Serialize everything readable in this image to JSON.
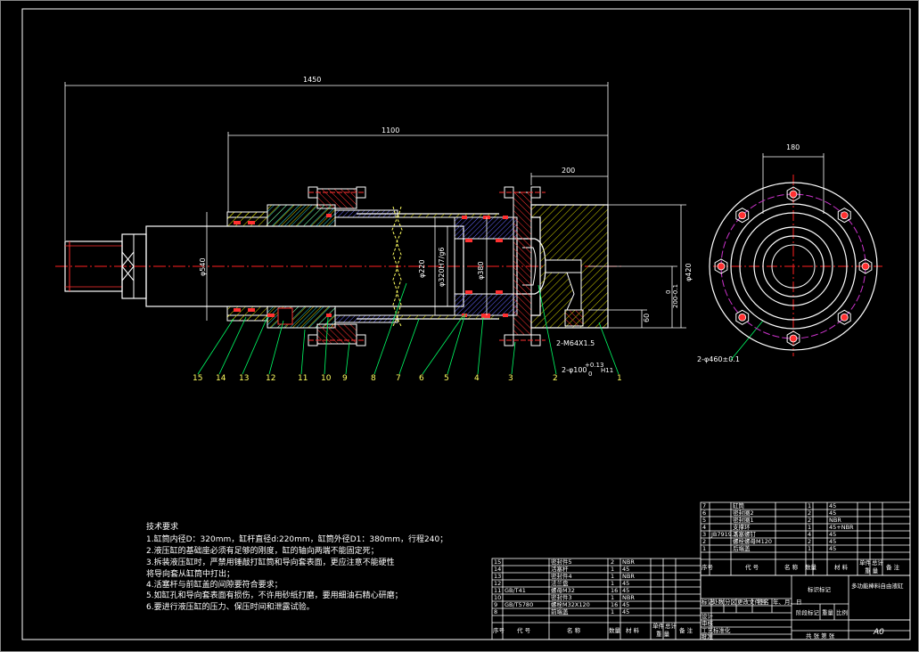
{
  "dimensions": {
    "overall_length": "1450",
    "stroke_length": "1100",
    "head_length": "200",
    "end_diameter": "φ540",
    "rod_diameter": "φ220",
    "piston_fit": "φ320H7/g6",
    "piston_diameter": "φ380",
    "flange_diameter": "φ420",
    "tol_upper": "0",
    "tol_lower": "200-0.1",
    "port_offset": "60",
    "thread_spec": "2-M64X1.5",
    "hole_spec": "2-φ100",
    "hole_tol_a": "+0.13",
    "hole_tol_b": "0",
    "hole_fit": "H11",
    "end_width": "180",
    "bolt_circle": "2-φ460±0.1"
  },
  "callouts": [
    "15",
    "14",
    "13",
    "12",
    "11",
    "10",
    "9",
    "8",
    "7",
    "6",
    "5",
    "4",
    "3",
    "2",
    "1"
  ],
  "tech": {
    "title": "技术要求",
    "lines": [
      "1.缸筒内径D：320mm，缸杆直径d:220mm，缸筒外径D1：380mm，行程240；",
      "2.液压缸的基础座必须有足够的刚度，缸的轴向两端不能固定死；",
      "3.拆装液压缸时，严禁用锤敲打缸筒和导向套表面，更应注意不能硬性",
      "将导向套从缸筒中打出；",
      "4.活塞杆与前缸盖的间隙要符合要求；",
      "5.如缸孔和导向套表面有损伤，不许用砂纸打磨，要用细油石精心研磨；",
      "6.要进行液压缸的压力、保压时间和泄露试验。"
    ]
  },
  "bom_upper": [
    {
      "no": "7",
      "code": "",
      "name": "缸筒",
      "qty": "1",
      "mat": "45"
    },
    {
      "no": "6",
      "code": "",
      "name": "密封圈2",
      "qty": "2",
      "mat": "45"
    },
    {
      "no": "5",
      "code": "",
      "name": "密封圈1",
      "qty": "2",
      "mat": "NBR"
    },
    {
      "no": "4",
      "code": "",
      "name": "支撑环",
      "qty": "1",
      "mat": "45+NBR"
    },
    {
      "no": "3",
      "code": "JB7919.3",
      "name": "活塞螺钉",
      "qty": "4",
      "mat": "45"
    },
    {
      "no": "2",
      "code": "",
      "name": "螺栓螺母M120",
      "qty": "2",
      "mat": "45"
    },
    {
      "no": "1",
      "code": "",
      "name": "后端盖",
      "qty": "1",
      "mat": "45"
    }
  ],
  "bom_lower": [
    {
      "no": "15",
      "code": "",
      "name": "密封件5",
      "qty": "2",
      "mat": "NBR"
    },
    {
      "no": "14",
      "code": "",
      "name": "活塞杆",
      "qty": "1",
      "mat": "45"
    },
    {
      "no": "13",
      "code": "",
      "name": "密封件4",
      "qty": "1",
      "mat": "NBR"
    },
    {
      "no": "12",
      "code": "",
      "name": "法兰盘",
      "qty": "1",
      "mat": "45"
    },
    {
      "no": "11",
      "code": "GB/T41",
      "name": "螺母M32",
      "qty": "16",
      "mat": "45"
    },
    {
      "no": "10",
      "code": "",
      "name": "密封件3",
      "qty": "1",
      "mat": "NBR"
    },
    {
      "no": "9",
      "code": "GB/T5780",
      "name": "螺栓M32X120",
      "qty": "16",
      "mat": "45"
    },
    {
      "no": "8",
      "code": "",
      "name": "前端盖",
      "qty": "1",
      "mat": "45"
    }
  ],
  "bom_header": {
    "no": "序号",
    "code": "代 号",
    "name": "名 称",
    "qty": "数量",
    "mat": "材 料",
    "w1": "单件",
    "w2": "总计",
    "w3": "重 量",
    "remark": "备 注"
  },
  "title_block": {
    "drawing_title": "多功能棒料自由液缸",
    "material_mark": "标识标记",
    "stage": "阶段标记",
    "weight": "重量",
    "scale": "比例",
    "sheet": "A0",
    "sheets": "共 张 第 张",
    "rows": [
      "标记",
      "处数",
      "分区",
      "更改文件号",
      "签名",
      "年、月、日"
    ],
    "roles": [
      "设计",
      "审核",
      "工艺",
      "标准化",
      "批准"
    ]
  },
  "colors": {
    "line": "#ffffff",
    "dim": "#ffffff",
    "hatch_red": "#ff3030",
    "hatch_yellow": "#ffff60",
    "center": "#ff2020",
    "circle": "#cc33cc",
    "leader": "#00ff66"
  }
}
